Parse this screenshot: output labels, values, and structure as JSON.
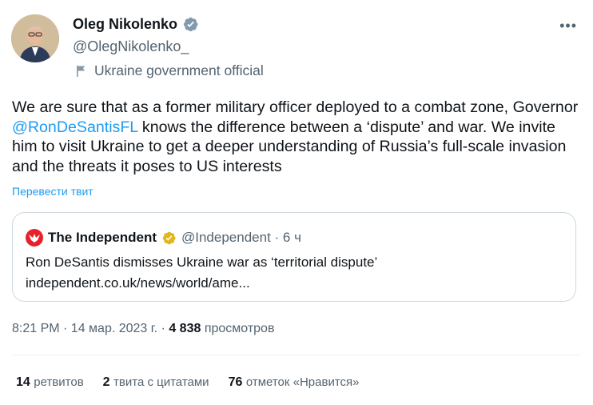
{
  "author": {
    "name": "Oleg Nikolenko",
    "handle": "@OlegNikolenko_",
    "affiliation": "Ukraine government official"
  },
  "tweet": {
    "text_before": "We are sure that as a former military officer deployed to a combat zone, Governor ",
    "mention": "@RonDeSantisFL",
    "text_after": " knows the difference between a ‘dispute’ and war. We invite him to visit Ukraine to get a deeper understanding of Russia’s full-scale invasion and the threats it poses to US interests",
    "translate_label": "Перевести твит"
  },
  "quote": {
    "name": "The Independent",
    "handle_time": "@Independent · 6 ч",
    "text": "Ron DeSantis dismisses Ukraine war as ‘territorial dispute’",
    "link": "independent.co.uk/news/world/ame..."
  },
  "meta": {
    "datetime": "8:21 PM · 14 мар. 2023 г. · ",
    "views_count": "4 838",
    "views_label": " просмотров"
  },
  "stats": {
    "retweets_count": "14",
    "retweets_label": "ретвитов",
    "quotes_count": "2",
    "quotes_label": "твита с цитатами",
    "likes_count": "76",
    "likes_label": "отметок «Нравится»"
  },
  "icons": {
    "more": "more-horizontal-icon",
    "verified": "verified-badge-icon",
    "flag": "flag-icon",
    "quote_logo": "independent-eagle-logo",
    "quote_verified": "gold-verified-badge-icon"
  },
  "colors": {
    "accent": "#1d9bf0",
    "secondary_text": "#536471",
    "gold_badge": "#e2b719",
    "independent_red": "#e8202a"
  }
}
